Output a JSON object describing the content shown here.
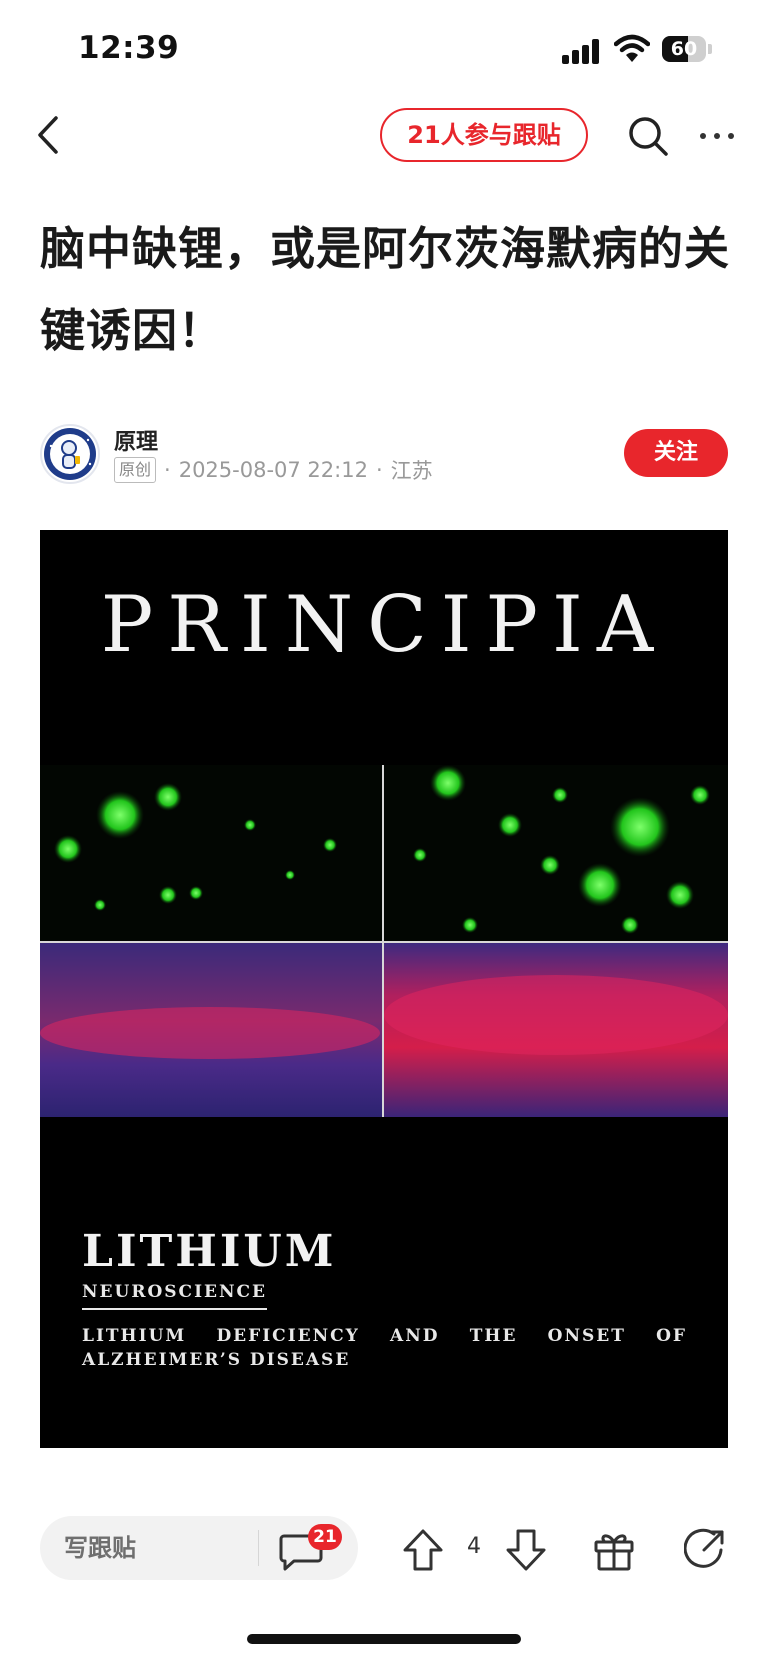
{
  "status_bar": {
    "time": "12:39",
    "battery": "60"
  },
  "nav": {
    "participants_pill": "21人参与跟贴"
  },
  "article": {
    "title": "脑中缺锂，或是阿尔茨海默病的关键诱因！",
    "author": "原理",
    "original_badge": "原创",
    "datetime": "2025-08-07 22:12",
    "location": "江苏",
    "separator": "·",
    "follow_label": "关注"
  },
  "cover": {
    "title": "PRINCIPIA",
    "topic": "LITHIUM",
    "section": "NEUROSCIENCE",
    "subtitle": "LITHIUM DEFICIENCY AND THE ONSET OF ALZHEIMER’S DISEASE"
  },
  "bottom_bar": {
    "write_comment": "写跟贴",
    "comment_count": "21",
    "vote_count": "4"
  },
  "colors": {
    "accent": "#e8262c",
    "image_bg": "#000000"
  },
  "icons": [
    "back-icon",
    "search-icon",
    "more-icon",
    "comment-icon",
    "upvote-icon",
    "downvote-icon",
    "gift-icon",
    "share-icon"
  ]
}
